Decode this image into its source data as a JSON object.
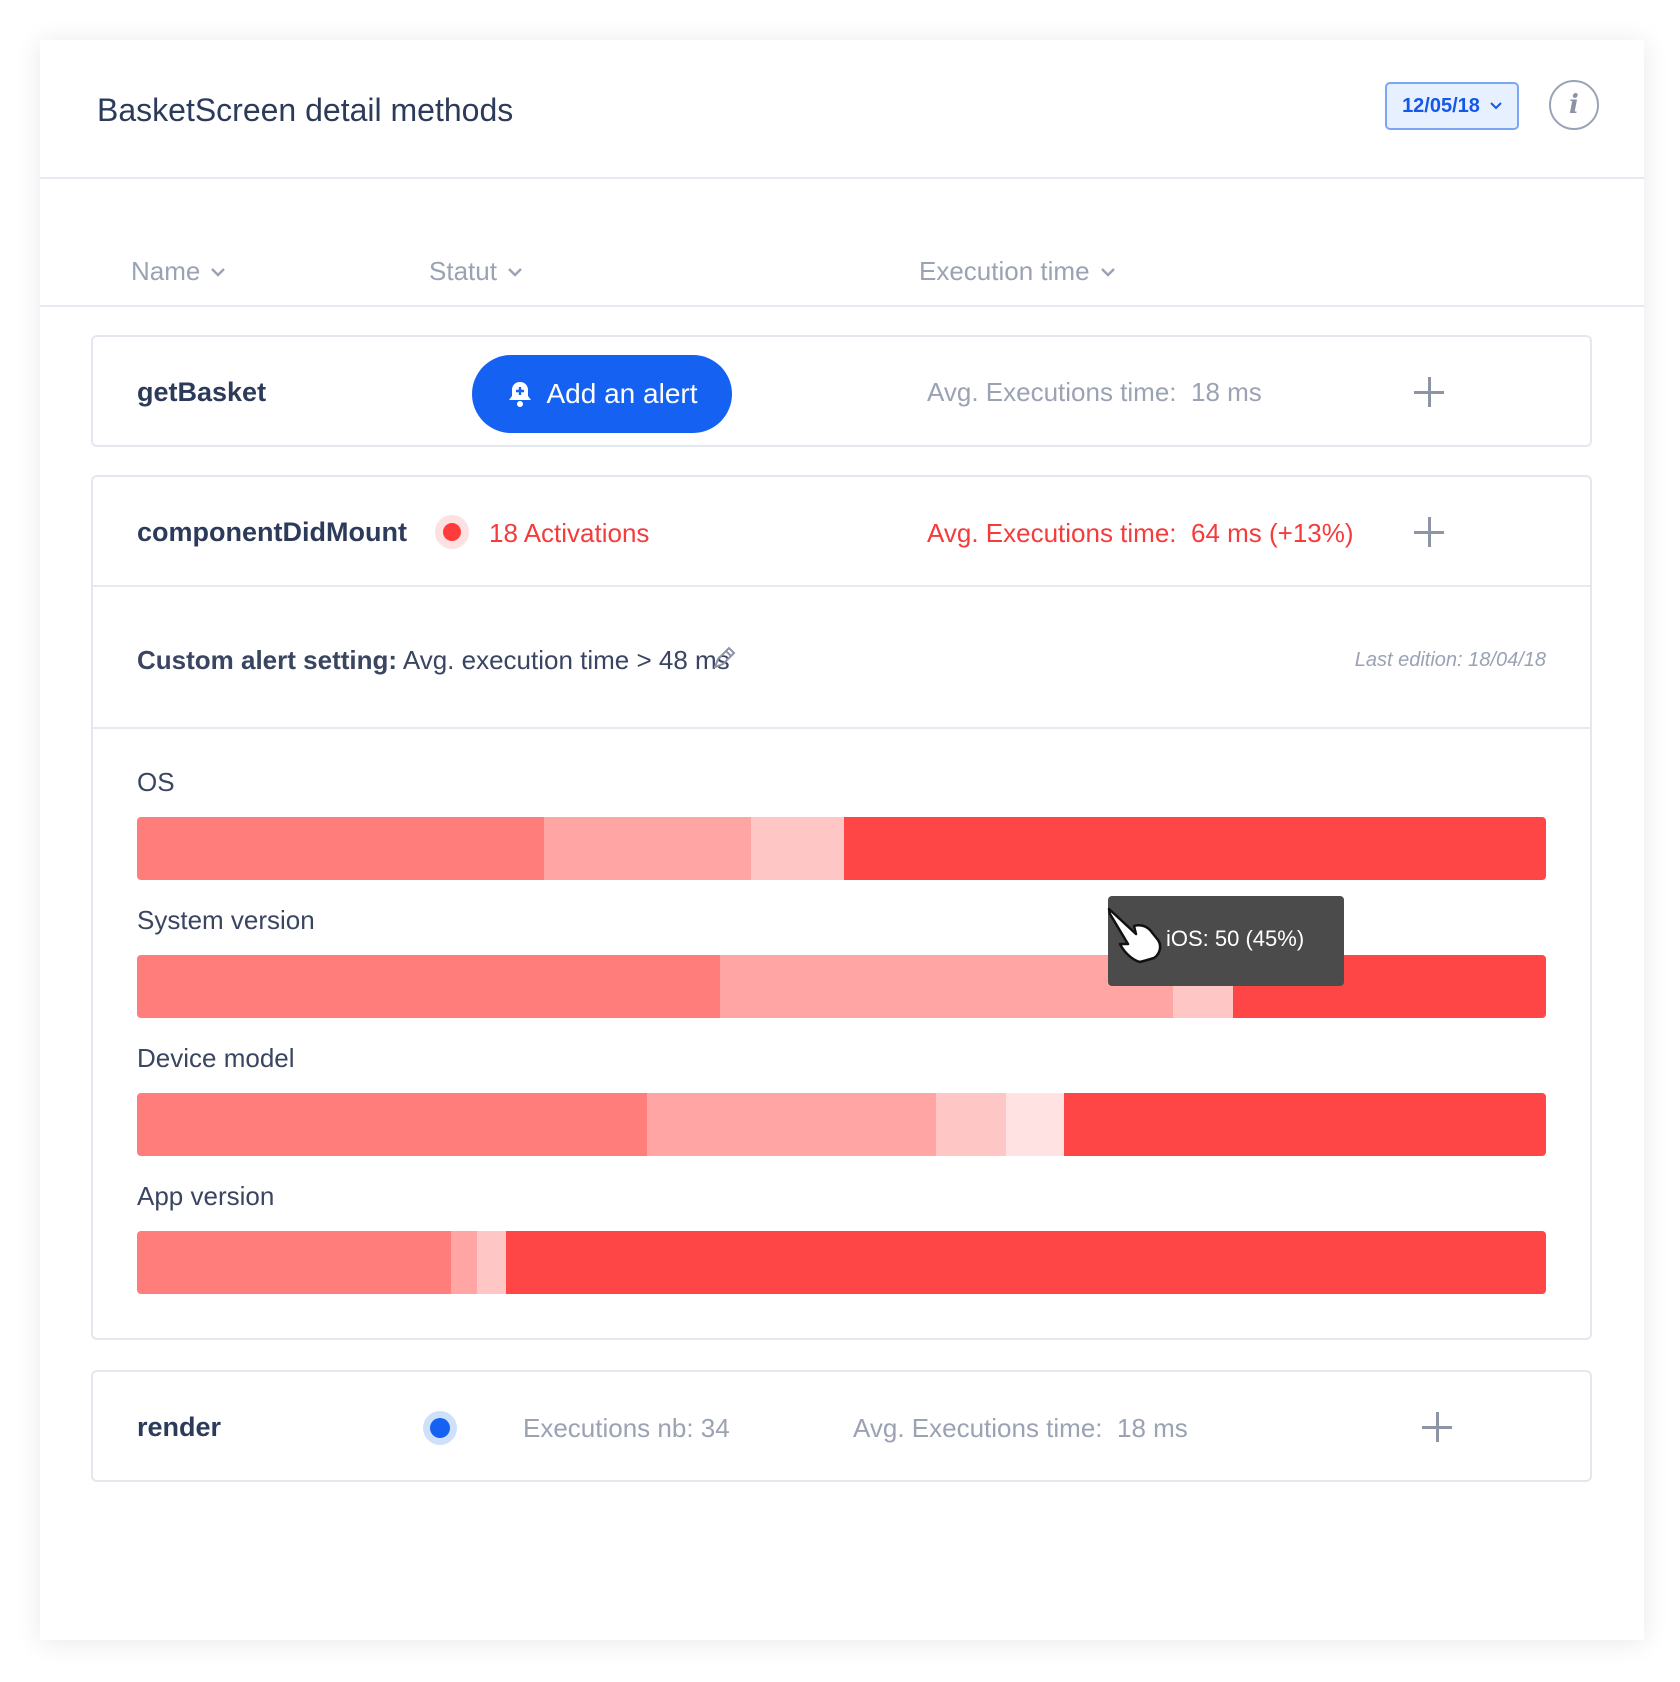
{
  "header": {
    "title": "BasketScreen detail methods",
    "date": "12/05/18",
    "info_icon": "info-icon"
  },
  "columns": {
    "name": "Name",
    "statut": "Statut",
    "execution_time": "Execution time"
  },
  "methods": [
    {
      "name": "getBasket",
      "action_label": "Add an alert",
      "avg_label": "Avg. Executions time:",
      "avg_value": "18 ms"
    },
    {
      "name": "componentDidMount",
      "status": "18 Activations",
      "avg_label": "Avg. Executions time:",
      "avg_value": "64 ms (+13%)",
      "custom_alert_label": "Custom alert setting:",
      "custom_alert_value": "Avg. execution time > 48 ms",
      "last_edition": "Last edition: 18/04/18",
      "breakdowns": [
        {
          "label": "OS",
          "segments_percent": [
            28.9,
            14.7,
            6.6,
            49.8
          ]
        },
        {
          "label": "System version",
          "segments_percent": [
            41.4,
            32.1,
            4.3,
            22.2
          ]
        },
        {
          "label": "Device model",
          "segments_percent": [
            36.2,
            20.5,
            5.0,
            4.1,
            34.2
          ]
        },
        {
          "label": "App version",
          "segments_percent": [
            22.3,
            1.8,
            2.1,
            73.8
          ]
        }
      ],
      "tooltip": "iOS: 50 (45%)"
    },
    {
      "name": "render",
      "executions": "Executions nb: 34",
      "avg_label": "Avg. Executions time:",
      "avg_value": "18 ms"
    }
  ],
  "colors": {
    "primary": "#1461f2",
    "alert_red": "#f43c3c",
    "bar_shades": [
      "#ff7d7b",
      "#ffa5a3",
      "#ffc6c6",
      "#ffe2e1",
      "#ff4646"
    ]
  }
}
